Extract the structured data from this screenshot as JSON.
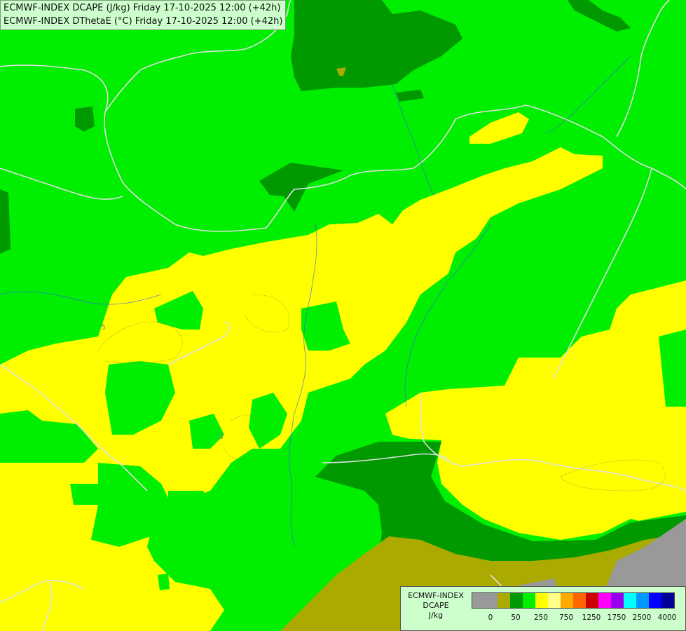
{
  "header": {
    "line1": "ECMWF-INDEX DCAPE (J/kg) Friday 17-10-2025 12:00 (+42h)",
    "line2": "ECMWF-INDEX DThetaE (°C) Friday 17-10-2025 12:00 (+42h)"
  },
  "contour_labels": [
    "5",
    "5"
  ],
  "legend": {
    "model": "ECMWF-INDEX",
    "parameter": "DCAPE",
    "unit": "J/kg",
    "colors": [
      "#999999",
      "#999999",
      "#aaaa00",
      "#009900",
      "#00ee00",
      "#ffff00",
      "#ffff88",
      "#ffaa00",
      "#ff6600",
      "#cc0000",
      "#ff00ff",
      "#9900ee",
      "#00ffff",
      "#0099ff",
      "#0000ff",
      "#000099"
    ],
    "tick_labels": [
      "0",
      "50",
      "250",
      "750",
      "1250",
      "1750",
      "2500",
      "4000"
    ]
  },
  "map_colors": {
    "green_light": "#00ee00",
    "green_dark": "#009900",
    "yellow": "#ffff00",
    "olive": "#aaaa00",
    "grey": "#999999"
  }
}
